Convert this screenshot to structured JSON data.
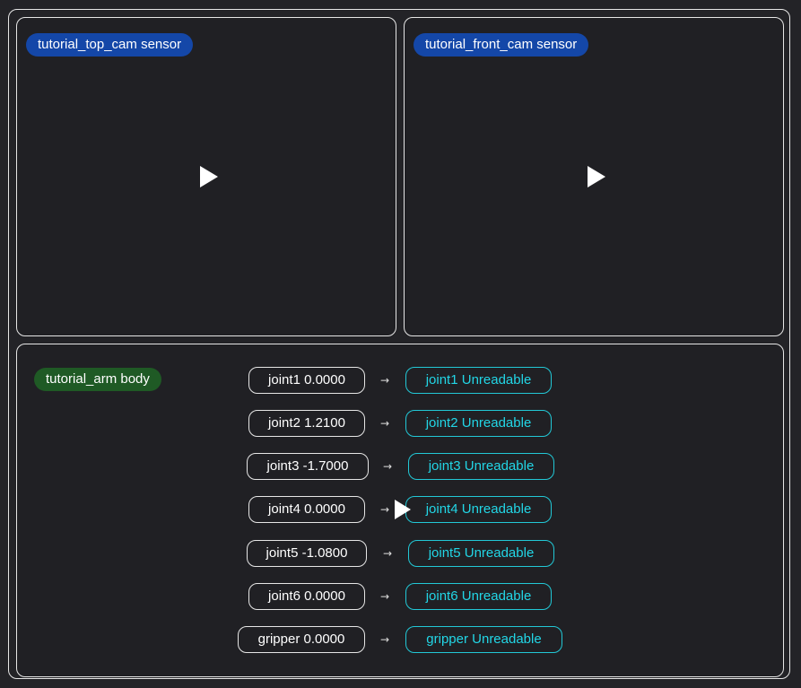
{
  "sensors": [
    {
      "label": "tutorial_top_cam sensor",
      "icon": "play-icon"
    },
    {
      "label": "tutorial_front_cam sensor",
      "icon": "play-icon"
    }
  ],
  "body": {
    "label": "tutorial_arm body",
    "arrow_glyph": "→",
    "joints": [
      {
        "source": "joint1 0.0000",
        "target": "joint1 Unreadable"
      },
      {
        "source": "joint2 1.2100",
        "target": "joint2 Unreadable"
      },
      {
        "source": "joint3 -1.7000",
        "target": "joint3 Unreadable"
      },
      {
        "source": "joint4 0.0000",
        "target": "joint4 Unreadable"
      },
      {
        "source": "joint5 -1.0800",
        "target": "joint5 Unreadable"
      },
      {
        "source": "joint6 0.0000",
        "target": "joint6 Unreadable"
      },
      {
        "source": "gripper 0.0000",
        "target": "gripper Unreadable"
      }
    ]
  },
  "colors": {
    "background": "#232327",
    "sensor_badge": "#1447a8",
    "body_badge": "#1f5a25",
    "target_accent": "#22d6e6"
  }
}
